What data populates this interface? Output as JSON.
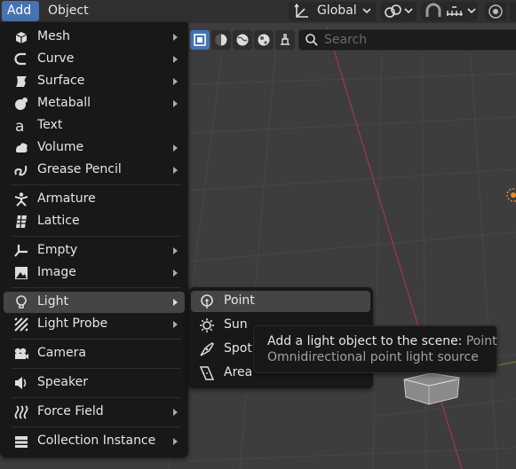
{
  "colors": {
    "accent": "#4772b3",
    "menu_bg": "#181818",
    "hover_bg": "#454545",
    "viewport_bg": "#3d3d3d",
    "x_axis": "#a13a44"
  },
  "header": {
    "tabs": [
      "Add",
      "Object"
    ],
    "orientation_label": "Global",
    "icons": [
      "transform-orientation-icon",
      "pivot-link-icon",
      "snap-magnet-icon",
      "snap-increment-icon",
      "overlay-circle-icon"
    ]
  },
  "toolbar": {
    "mode_icons": [
      "cube-select-icon",
      "sphere-shade-icon",
      "globe-icon",
      "globe-alt-icon",
      "brush-icon"
    ],
    "search_placeholder": "Search"
  },
  "add_menu": {
    "items": [
      {
        "label": "Mesh",
        "icon": "mesh-icon",
        "submenu": true
      },
      {
        "label": "Curve",
        "icon": "curve-icon",
        "submenu": true
      },
      {
        "label": "Surface",
        "icon": "surface-icon",
        "submenu": true
      },
      {
        "label": "Metaball",
        "icon": "metaball-icon",
        "submenu": true
      },
      {
        "label": "Text",
        "icon": "text-icon",
        "submenu": false
      },
      {
        "label": "Volume",
        "icon": "volume-icon",
        "submenu": true
      },
      {
        "label": "Grease Pencil",
        "icon": "grease-pencil-icon",
        "submenu": true
      },
      {
        "label": "Armature",
        "icon": "armature-icon",
        "submenu": false
      },
      {
        "label": "Lattice",
        "icon": "lattice-icon",
        "submenu": false
      },
      {
        "label": "Empty",
        "icon": "empty-icon",
        "submenu": true
      },
      {
        "label": "Image",
        "icon": "image-icon",
        "submenu": true
      },
      {
        "label": "Light",
        "icon": "light-icon",
        "submenu": true
      },
      {
        "label": "Light Probe",
        "icon": "light-probe-icon",
        "submenu": true
      },
      {
        "label": "Camera",
        "icon": "camera-icon",
        "submenu": false
      },
      {
        "label": "Speaker",
        "icon": "speaker-icon",
        "submenu": false
      },
      {
        "label": "Force Field",
        "icon": "force-field-icon",
        "submenu": true
      },
      {
        "label": "Collection Instance",
        "icon": "collection-icon",
        "submenu": true
      }
    ],
    "active_item": "Light"
  },
  "light_submenu": {
    "items": [
      {
        "label": "Point",
        "icon": "point-light-icon"
      },
      {
        "label": "Sun",
        "icon": "sun-light-icon"
      },
      {
        "label": "Spot",
        "icon": "spot-light-icon"
      },
      {
        "label": "Area",
        "icon": "area-light-icon"
      }
    ],
    "active_item": "Point"
  },
  "tooltip": {
    "line1_text": "Add a light object to the scene:",
    "line1_keyword": "Point",
    "line2": "Omnidirectional point light source"
  }
}
